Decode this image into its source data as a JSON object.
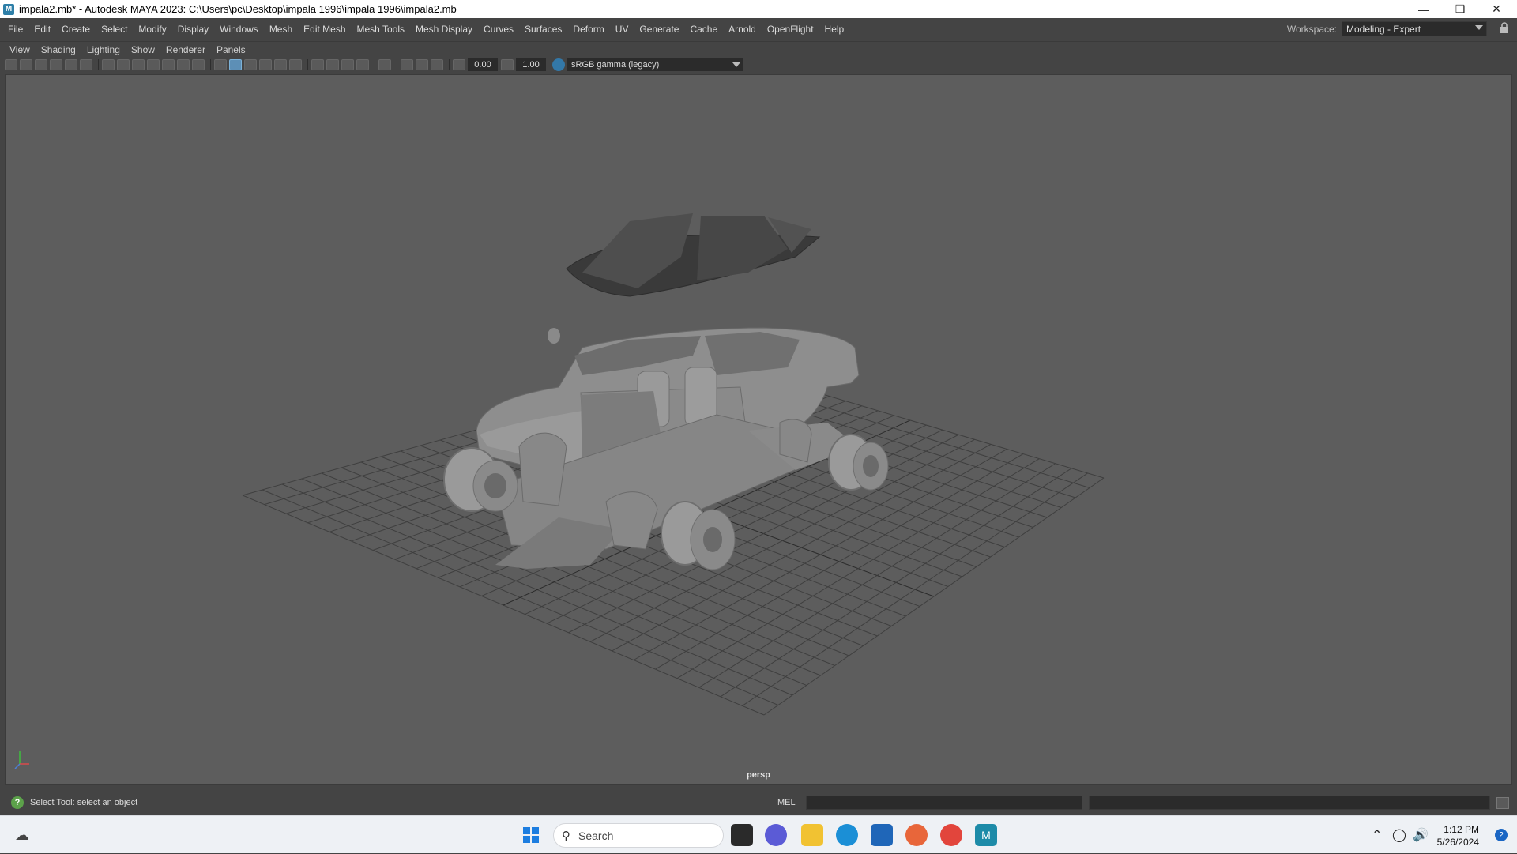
{
  "window": {
    "title": "impala2.mb* - Autodesk MAYA 2023: C:\\Users\\pc\\Desktop\\impala 1996\\impala 1996\\impala2.mb",
    "app_icon_letter": "M"
  },
  "menu": {
    "items": [
      "File",
      "Edit",
      "Create",
      "Select",
      "Modify",
      "Display",
      "Windows",
      "Mesh",
      "Edit Mesh",
      "Mesh Tools",
      "Mesh Display",
      "Curves",
      "Surfaces",
      "Deform",
      "UV",
      "Generate",
      "Cache",
      "Arnold",
      "OpenFlight",
      "Help"
    ]
  },
  "workspace": {
    "label": "Workspace:",
    "value": "Modeling - Expert"
  },
  "panel_menu": {
    "items": [
      "View",
      "Shading",
      "Lighting",
      "Show",
      "Renderer",
      "Panels"
    ]
  },
  "viewport_toolbar": {
    "exposure": "0.00",
    "gamma": "1.00",
    "color_space": "sRGB gamma (legacy)"
  },
  "viewport": {
    "camera_label": "persp",
    "background": "#5d5d5d",
    "grid_color": "#3f3f3f"
  },
  "status": {
    "help_text": "Select Tool: select an object",
    "command_language": "MEL"
  },
  "taskbar": {
    "search_placeholder": "Search",
    "time": "1:12 PM",
    "date": "5/26/2024",
    "notification_count": "2"
  }
}
